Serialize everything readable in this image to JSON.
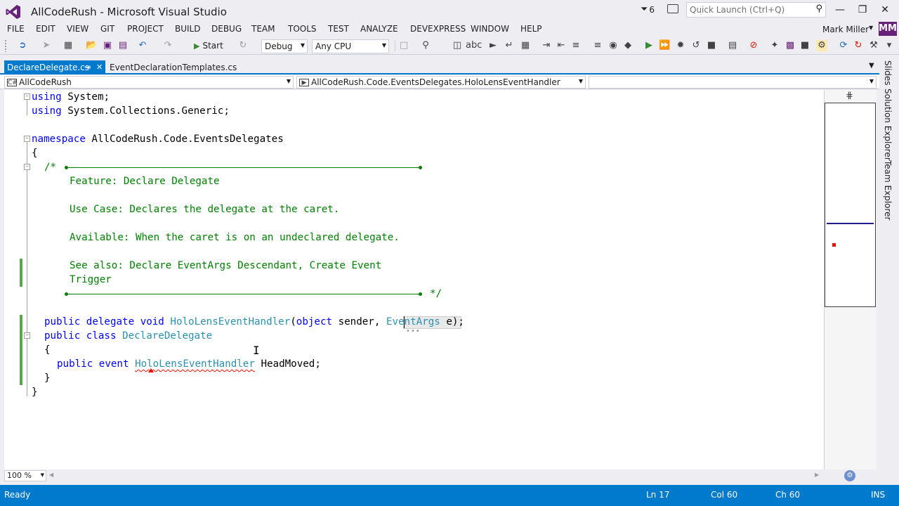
{
  "window": {
    "title": "AllCodeRush - Microsoft Visual Studio",
    "notification_count": "6",
    "quick_launch_placeholder": "Quick Launch (Ctrl+Q)",
    "minimize": "—",
    "maximize": "❐",
    "close": "✕"
  },
  "menu": [
    "FILE",
    "EDIT",
    "VIEW",
    "GIT",
    "PROJECT",
    "BUILD",
    "DEBUG",
    "TEAM",
    "TOOLS",
    "TEST",
    "ANALYZE",
    "DEVEXPRESS",
    "WINDOW",
    "HELP"
  ],
  "user": {
    "name": "Mark Miller",
    "initials": "MM"
  },
  "toolbar": {
    "start_label": "Start",
    "configuration": "Debug",
    "platform": "Any CPU"
  },
  "tabs": [
    {
      "label": "DeclareDelegate.cs",
      "active": true,
      "pin": "⇥",
      "close": "✕"
    },
    {
      "label": "EventDeclarationTemplates.cs",
      "active": false
    }
  ],
  "navbar": {
    "project": "AllCodeRush",
    "member": "AllCodeRush.Code.EventsDelegates.HoloLensEventHandler",
    "third": ""
  },
  "code": {
    "l1_kw": "using",
    "l1_rest": " System;",
    "l2_kw": "using",
    "l2_rest": " System.Collections.Generic;",
    "l4_kw": "namespace",
    "l4_rest": " AllCodeRush.Code.EventsDelegates",
    "l5": "{",
    "l6": "/*",
    "l7": "Feature: Declare Delegate",
    "l9": "Use Case: Declares the delegate at the caret.",
    "l11": "Available: When the caret is on an undeclared delegate.",
    "l13": "See also: Declare EventArgs Descendant, Create Event",
    "l14": "Trigger",
    "l15_end": "*/",
    "l17_public": "public",
    "l17_delegate": "delegate",
    "l17_void": "void",
    "l17_name": "HoloLensEventHandler",
    "l17_open": "(",
    "l17_object": "object",
    "l17_sender": " sender, ",
    "l17_eventargs": "EventArgs",
    "l17_tail": " e);",
    "l18_public": "public",
    "l18_class": "class",
    "l18_name": "DeclareDelegate",
    "l19": "{",
    "l20_public": "public",
    "l20_event": "event",
    "l20_type": "HoloLensEventHandler",
    "l20_rest": " HeadMoved;",
    "l21": "}",
    "l22": "}"
  },
  "side_tabs": [
    "Slides",
    "Solution Explorer",
    "Team Explorer"
  ],
  "zoom": "100 %",
  "status": {
    "ready": "Ready",
    "ln": "Ln 17",
    "col": "Col 60",
    "ch": "Ch 60",
    "mode": "INS"
  },
  "colors": {
    "accent": "#007acc",
    "keyword": "#0000ff",
    "type": "#2b91af",
    "comment": "#008000",
    "avatar": "#68217a"
  }
}
